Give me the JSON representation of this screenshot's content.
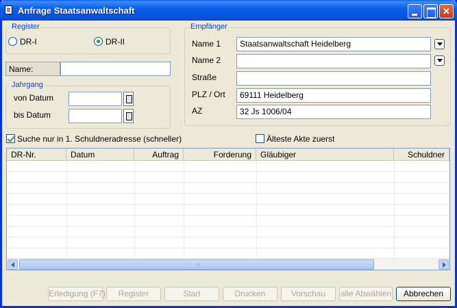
{
  "window": {
    "title": "Anfrage Staatsanwaltschaft"
  },
  "register": {
    "legend": "Register",
    "options": [
      {
        "label": "DR-I",
        "checked": false
      },
      {
        "label": "DR-II",
        "checked": true
      }
    ]
  },
  "name_filter": {
    "label": "Name:",
    "value": ""
  },
  "jahrgang": {
    "legend": "Jahrgang",
    "von_label": "von Datum",
    "von_value": "",
    "bis_label": "bis Datum",
    "bis_value": ""
  },
  "empfaenger": {
    "legend": "Empfänger",
    "name1_label": "Name 1",
    "name1_value": "Staatsanwaltschaft Heidelberg",
    "name2_label": "Name 2",
    "name2_value": "",
    "strasse_label": "Straße",
    "strasse_value": "",
    "plz_label": "PLZ / Ort",
    "plz_value": "69111 Heidelberg",
    "az_label": "AZ",
    "az_value": "32 Js 1006/04"
  },
  "options": {
    "suche_label": "Suche nur in 1. Schuldneradresse (schneller)",
    "suche_checked": true,
    "aelteste_label": "Älteste Akte zuerst",
    "aelteste_checked": false
  },
  "table": {
    "columns": [
      "DR-Nr.",
      "Datum",
      "Auftrag",
      "Forderung",
      "Gläubiger",
      "Schuldner"
    ],
    "rows": []
  },
  "buttons": {
    "erledigung": "Erledigung (F7)",
    "register": "Register",
    "start": "Start",
    "drucken": "Drucken",
    "vorschau": "Vorschau",
    "alle_abwaehlen": "alle Abwählen",
    "abbrechen": "Abbrechen"
  },
  "colors": {
    "title_bar": "#0a5fea",
    "legend_text": "#0046d5",
    "check_green": "#21a121"
  }
}
